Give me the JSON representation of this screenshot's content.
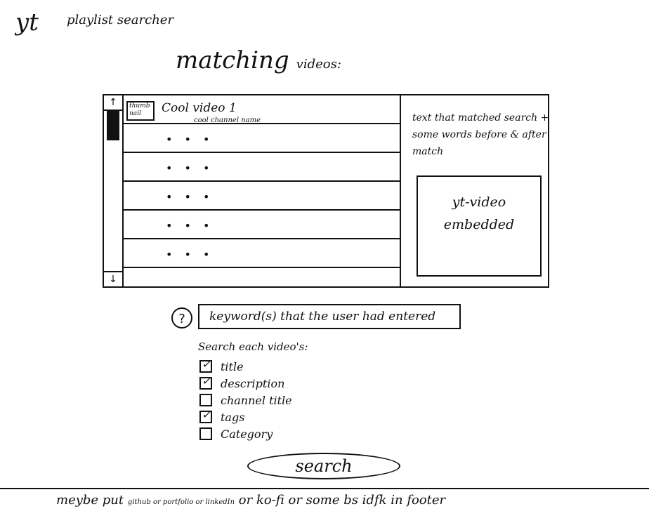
{
  "app": {
    "logo": "yt",
    "title": "playlist searcher"
  },
  "heading": {
    "main": "matching",
    "sub": "videos:"
  },
  "results": {
    "videos": [
      {
        "thumbnail_label": "thumb nail",
        "title": "Cool video 1",
        "channel": "cool channel name"
      },
      {
        "placeholder": "• • •"
      },
      {
        "placeholder": "• • •"
      },
      {
        "placeholder": "• • •"
      },
      {
        "placeholder": "• • •"
      },
      {
        "placeholder": "• • •"
      },
      {
        "placeholder": ""
      }
    ],
    "scroll_up": "↑",
    "scroll_down": "↓"
  },
  "preview": {
    "match_text": "text that matched search + some words before & after match",
    "embed_label": "yt-video embedded"
  },
  "search": {
    "help_icon": "?",
    "keywords_value": "keyword(s) that the user had entered",
    "each_label": "Search each video's:",
    "options": [
      {
        "label": "title",
        "checked": true
      },
      {
        "label": "description",
        "checked": true
      },
      {
        "label": "channel title",
        "checked": false
      },
      {
        "label": "tags",
        "checked": true
      },
      {
        "label": "Category",
        "checked": false
      }
    ],
    "button_label": "search"
  },
  "footer": {
    "part1": "meybe put",
    "part2": "github or portfolio or linkedIn",
    "part3": "or ko-fi or some bs idfk in footer"
  }
}
